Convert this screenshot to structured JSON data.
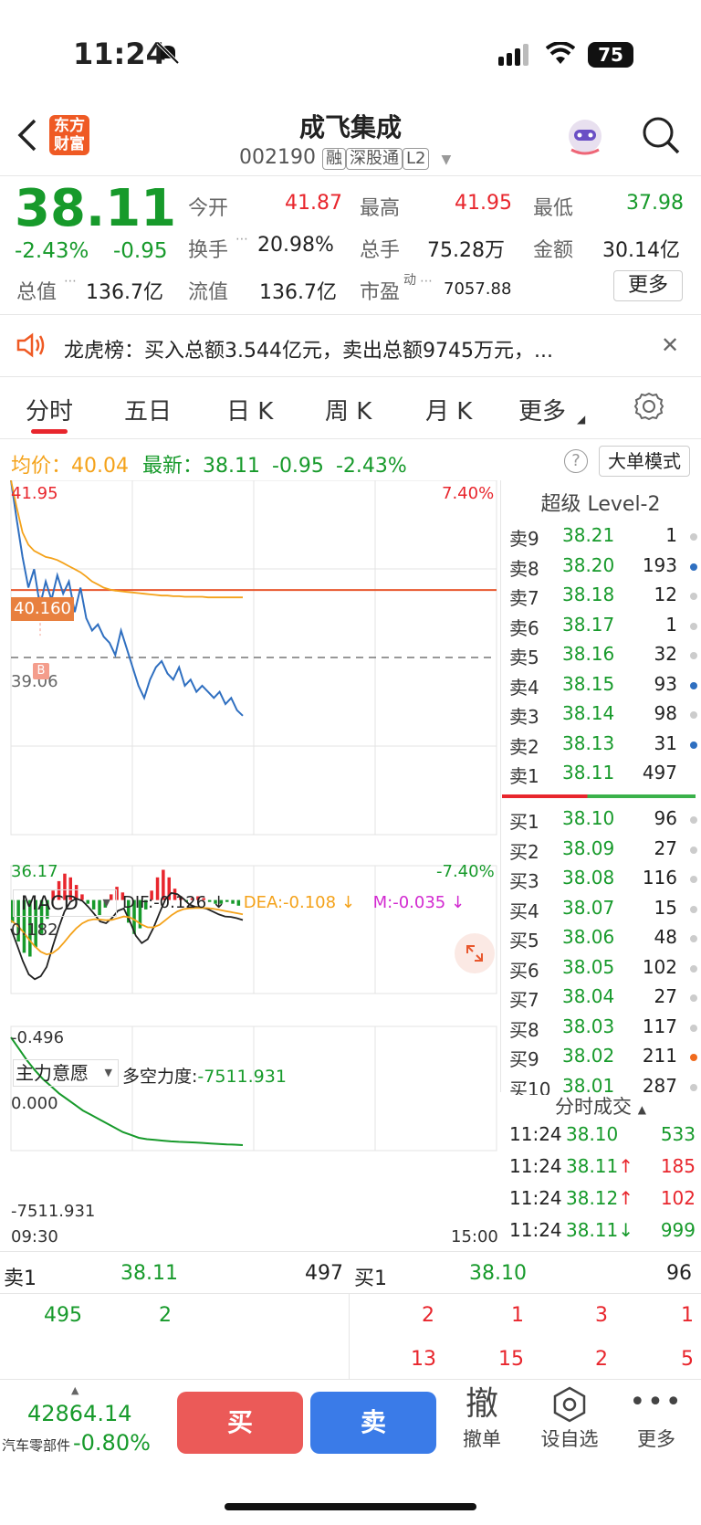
{
  "status_bar": {
    "time": "11:24",
    "battery": "75"
  },
  "header": {
    "logo_text": "东方财富",
    "stock_name": "成飞集成",
    "stock_code": "002190",
    "badges": [
      "融",
      "深股通",
      "L2"
    ]
  },
  "quote": {
    "price": "38.11",
    "change_pct": "-2.43%",
    "change": "-0.95",
    "open_label": "今开",
    "open": "41.87",
    "high_label": "最高",
    "high": "41.95",
    "low_label": "最低",
    "low": "37.98",
    "turnover_label": "换手",
    "turnover": "20.98%",
    "volume_label": "总手",
    "volume": "75.28万",
    "amount_label": "金额",
    "amount": "30.14亿",
    "mktcap_label": "总值",
    "mktcap": "136.7亿",
    "float_label": "流值",
    "float": "136.7亿",
    "pe_label": "市盈",
    "pe_sup": "动",
    "pe": "7057.88",
    "more_label": "更多"
  },
  "notice": {
    "text": "龙虎榜：买入总额3.544亿元，卖出总额9745万元，..."
  },
  "tabs": [
    {
      "label": "分时",
      "active": true
    },
    {
      "label": "五日"
    },
    {
      "label": "日 K"
    },
    {
      "label": "周 K"
    },
    {
      "label": "月 K"
    },
    {
      "label": "更多"
    }
  ],
  "chart_info": {
    "avg_label": "均价：",
    "avg_value": "40.04",
    "latest_label": "最新：",
    "latest_value": "38.11",
    "latest_change": "-0.95",
    "latest_pct": "-2.43%",
    "mode_button": "大单模式"
  },
  "chart_data": [
    {
      "type": "line",
      "series": [
        {
          "name": "价格",
          "color": "#2f6fc0",
          "values": [
            41.95,
            41.3,
            40.7,
            40.2,
            40.5,
            39.9,
            40.3,
            40.0,
            40.4,
            40.1,
            40.3,
            39.8,
            40.2,
            39.7,
            39.5,
            39.6,
            39.4,
            39.3,
            39.1,
            39.5,
            39.2,
            38.9,
            38.6,
            38.4,
            38.7,
            38.9,
            39.0,
            38.8,
            38.7,
            38.9,
            38.6,
            38.7,
            38.5,
            38.6,
            38.5,
            38.4,
            38.5,
            38.3,
            38.4,
            38.2,
            38.11
          ]
        },
        {
          "name": "均价",
          "color": "#f4a21a",
          "values": [
            41.95,
            41.5,
            41.1,
            40.9,
            40.8,
            40.75,
            40.7,
            40.68,
            40.65,
            40.6,
            40.55,
            40.5,
            40.45,
            40.38,
            40.3,
            40.25,
            40.2,
            40.17,
            40.15,
            40.14,
            40.13,
            40.12,
            40.11,
            40.1,
            40.09,
            40.08,
            40.07,
            40.07,
            40.06,
            40.06,
            40.05,
            40.05,
            40.05,
            40.05,
            40.04,
            40.04,
            40.04,
            40.04,
            40.04,
            40.04,
            40.04
          ]
        }
      ],
      "y_top": "41.95",
      "y_bottom": "36.17",
      "y_top_pct": "7.40%",
      "y_bottom_pct": "-7.40%",
      "ylim": [
        36.17,
        41.95
      ],
      "hline": {
        "value": "40.160",
        "color": "#e8572d"
      },
      "mid_line": "39.06",
      "marker": "B",
      "x_start": "09:30",
      "x_end": "15:00"
    },
    {
      "type": "bar",
      "title": "MACD",
      "dif_label": "DIF:-0.126",
      "dea_label": "DEA:-0.108",
      "m_label": "M:-0.035",
      "y_top": "0.182",
      "y_bottom": "-0.496",
      "ylim": [
        -0.496,
        0.182
      ],
      "values": [
        -0.12,
        -0.22,
        -0.28,
        -0.3,
        -0.25,
        -0.18,
        -0.1,
        0.05,
        0.1,
        0.14,
        0.12,
        0.08,
        0.03,
        -0.02,
        -0.05,
        -0.08,
        -0.04,
        0.03,
        0.07,
        0.04,
        -0.12,
        -0.18,
        -0.15,
        -0.05,
        0.05,
        0.12,
        0.16,
        0.12,
        0.06,
        0.02,
        -0.01,
        0.01,
        0.02,
        0.01,
        -0.01,
        -0.02,
        -0.02,
        -0.01,
        -0.02,
        -0.03
      ]
    },
    {
      "type": "line",
      "title": "主力意愿",
      "label": "多空力度:",
      "value": "-7511.931",
      "y_top": "0.000",
      "y_bottom": "-7511.931",
      "ylim": [
        -7511.931,
        0
      ],
      "values": [
        0,
        -800,
        -1600,
        -2300,
        -2900,
        -3400,
        -3900,
        -4300,
        -4700,
        -5100,
        -5400,
        -5700,
        -6000,
        -6300,
        -6600,
        -6800,
        -7000,
        -7100,
        -7150,
        -7200,
        -7250,
        -7280,
        -7300,
        -7330,
        -7360,
        -7400,
        -7430,
        -7460,
        -7480,
        -7511.931
      ]
    }
  ],
  "orderbook": {
    "title": "超级 Level-2",
    "asks": [
      {
        "label": "卖9",
        "price": "38.21",
        "vol": "1",
        "dot": "#ccc"
      },
      {
        "label": "卖8",
        "price": "38.20",
        "vol": "193",
        "dot": "#2f6fc0"
      },
      {
        "label": "卖7",
        "price": "38.18",
        "vol": "12",
        "dot": "#ccc"
      },
      {
        "label": "卖6",
        "price": "38.17",
        "vol": "1",
        "dot": "#ccc"
      },
      {
        "label": "卖5",
        "price": "38.16",
        "vol": "32",
        "dot": "#ccc"
      },
      {
        "label": "卖4",
        "price": "38.15",
        "vol": "93",
        "dot": "#2f6fc0"
      },
      {
        "label": "卖3",
        "price": "38.14",
        "vol": "98",
        "dot": "#ccc"
      },
      {
        "label": "卖2",
        "price": "38.13",
        "vol": "31",
        "dot": "#2f6fc0"
      },
      {
        "label": "卖1",
        "price": "38.11",
        "vol": "497",
        "dot": "none"
      }
    ],
    "bids": [
      {
        "label": "买1",
        "price": "38.10",
        "vol": "96",
        "dot": "#ccc"
      },
      {
        "label": "买2",
        "price": "38.09",
        "vol": "27",
        "dot": "#ccc"
      },
      {
        "label": "买3",
        "price": "38.08",
        "vol": "116",
        "dot": "#ccc"
      },
      {
        "label": "买4",
        "price": "38.07",
        "vol": "15",
        "dot": "#ccc"
      },
      {
        "label": "买5",
        "price": "38.06",
        "vol": "48",
        "dot": "#ccc"
      },
      {
        "label": "买6",
        "price": "38.05",
        "vol": "102",
        "dot": "#ccc"
      },
      {
        "label": "买7",
        "price": "38.04",
        "vol": "27",
        "dot": "#ccc"
      },
      {
        "label": "买8",
        "price": "38.03",
        "vol": "117",
        "dot": "#ccc"
      },
      {
        "label": "买9",
        "price": "38.02",
        "vol": "211",
        "dot": "#f06a1e"
      },
      {
        "label": "买10",
        "price": "38.01",
        "vol": "287",
        "dot": "#ccc"
      }
    ]
  },
  "ticks": {
    "title": "分时成交",
    "rows": [
      {
        "time": "11:24",
        "price": "38.10",
        "arrow": "",
        "vol": "533",
        "pc": "green",
        "vc": "green"
      },
      {
        "time": "11:24",
        "price": "38.11",
        "arrow": "↑",
        "vol": "185",
        "pc": "green",
        "vc": "red"
      },
      {
        "time": "11:24",
        "price": "38.12",
        "arrow": "↑",
        "vol": "102",
        "pc": "green",
        "vc": "red"
      },
      {
        "time": "11:24",
        "price": "38.11",
        "arrow": "↓",
        "vol": "999",
        "pc": "green",
        "vc": "green"
      }
    ]
  },
  "queue": {
    "sell_label": "卖1",
    "sell_price": "38.11",
    "sell_vol": "497",
    "buy_label": "买1",
    "buy_price": "38.10",
    "buy_vol": "96",
    "sell_q": [
      "495",
      "2"
    ],
    "buy_q1": [
      "2",
      "1",
      "3",
      "1"
    ],
    "buy_q2": [
      "13",
      "15",
      "2",
      "5"
    ]
  },
  "bottom": {
    "index_value": "42864.14",
    "index_name": "汽车零部件",
    "index_pct": "-0.80%",
    "buy": "买",
    "sell": "卖",
    "cancel_glyph": "撤",
    "cancel": "撤单",
    "watch": "设自选",
    "more": "更多"
  }
}
